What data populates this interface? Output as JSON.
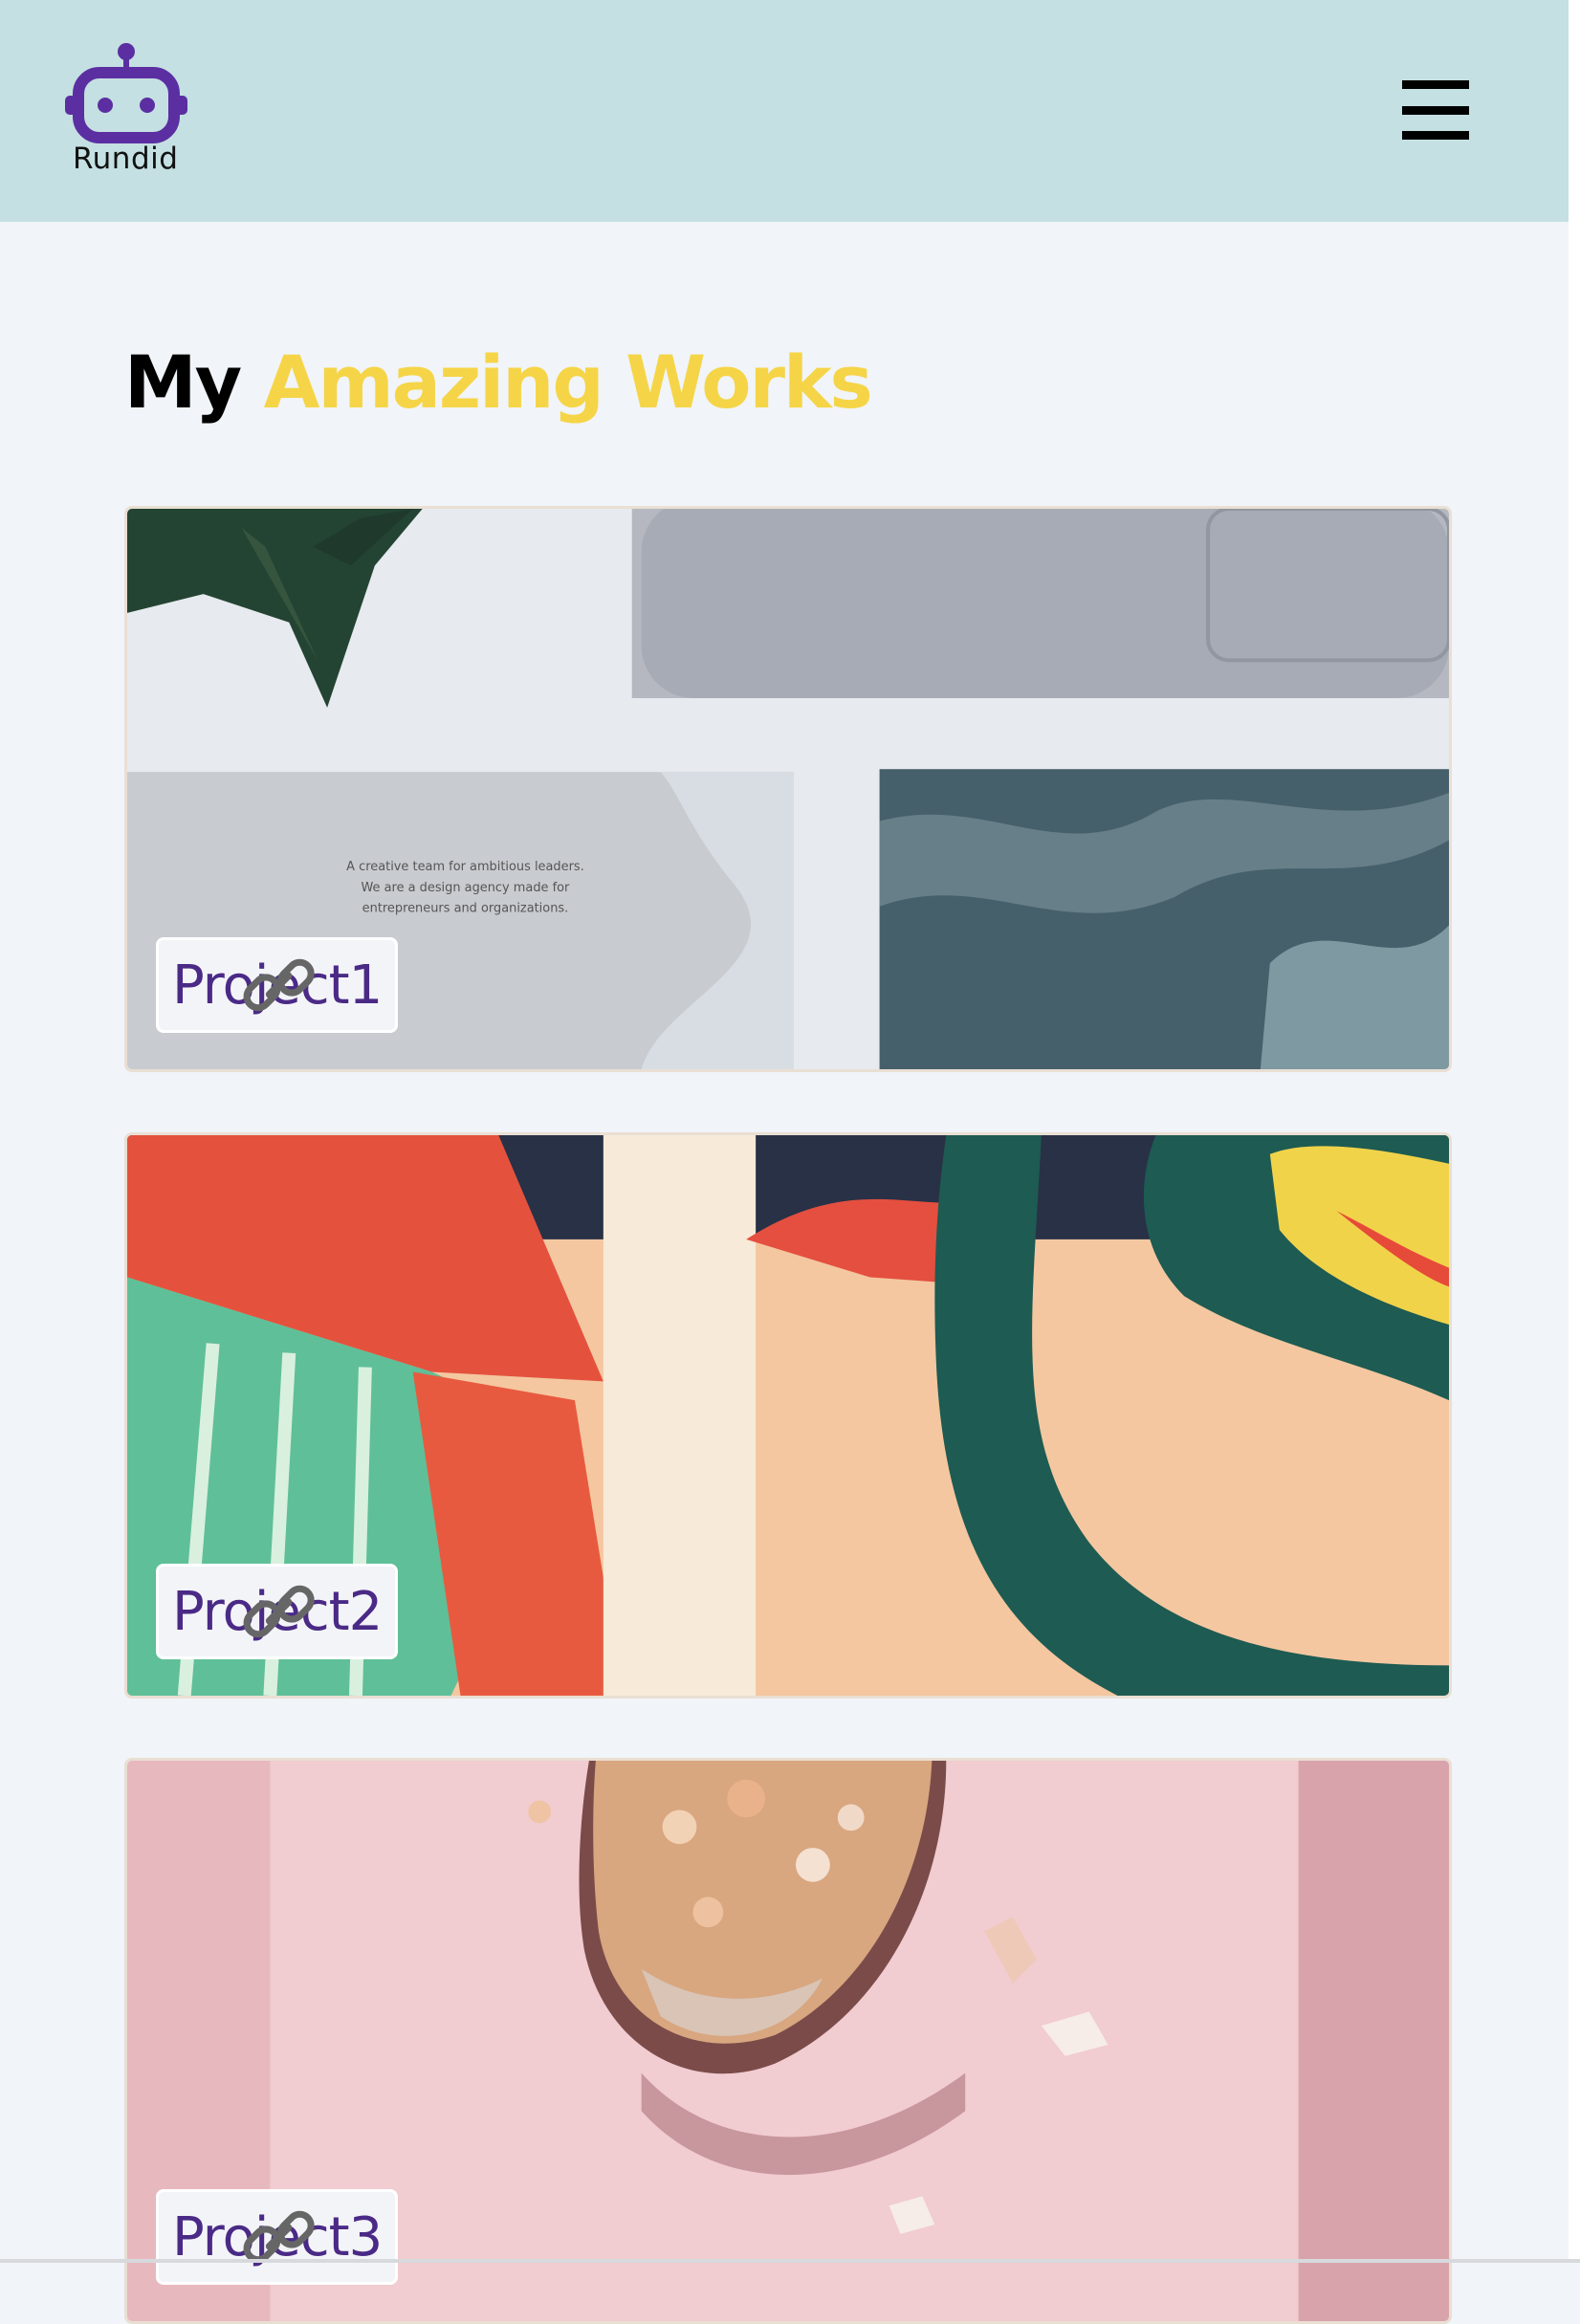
{
  "brand": {
    "name": "Rundid",
    "logo_icon": "robot-icon",
    "logo_color": "#5b2fa1"
  },
  "nav": {
    "menu_icon": "hamburger-menu-icon"
  },
  "hero": {
    "title_lead": "My",
    "title_accent": "Amazing Works",
    "accent_color": "#f5d547"
  },
  "projects": [
    {
      "label": "Project1",
      "link_icon": "link-icon",
      "image_text": [
        "A creative team for ambitious leaders.",
        "We are a design agency made for",
        "entrepreneurs and organizations."
      ]
    },
    {
      "label": "Project2",
      "link_icon": "link-icon"
    },
    {
      "label": "Project3",
      "link_icon": "link-icon"
    }
  ],
  "colors": {
    "header_bg": "#c4e0e2",
    "page_bg": "#f1f4f8",
    "label_text": "#4a2a86"
  }
}
